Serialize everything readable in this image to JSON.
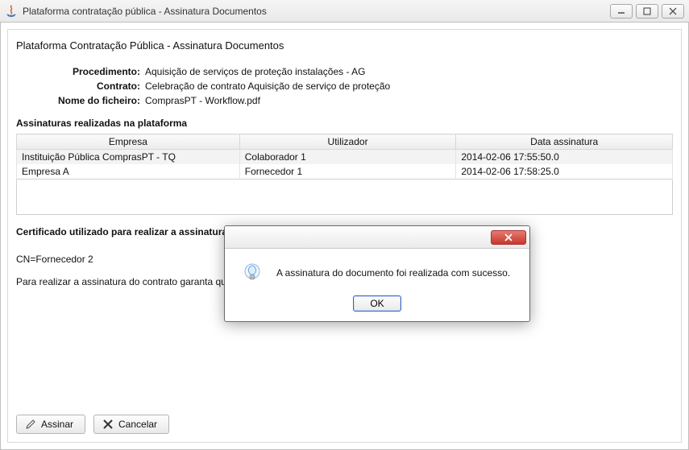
{
  "window": {
    "title": "Plataforma contratação pública - Assinatura Documentos"
  },
  "page": {
    "title": "Plataforma Contratação Pública - Assinatura Documentos"
  },
  "meta": {
    "procedimento_label": "Procedimento:",
    "procedimento_value": "Aquisição de serviços de proteção instalações - AG",
    "contrato_label": "Contrato:",
    "contrato_value": "Celebração de contrato Aquisição de serviço de proteção",
    "ficheiro_label": "Nome do ficheiro:",
    "ficheiro_value": "ComprasPT - Workflow.pdf"
  },
  "signatures": {
    "section_title": "Assinaturas realizadas na plataforma",
    "columns": {
      "empresa": "Empresa",
      "utilizador": "Utilizador",
      "data": "Data assinatura"
    },
    "rows": [
      {
        "empresa": "Instituição Pública ComprasPT - TQ",
        "utilizador": "Colaborador 1",
        "data": "2014-02-06 17:55:50.0"
      },
      {
        "empresa": "Empresa A",
        "utilizador": "Fornecedor 1",
        "data": "2014-02-06 17:58:25.0"
      }
    ]
  },
  "certificate": {
    "section_title": "Certificado utilizado para realizar a assinatura",
    "value": "CN=Fornecedor 2",
    "hint": "Para realizar a assinatura do contrato garanta que o cartão se encontra corretamente introduzido no leitor."
  },
  "buttons": {
    "assinar": "Assinar",
    "cancelar": "Cancelar"
  },
  "modal": {
    "message": "A assinatura do documento foi realizada com sucesso.",
    "ok": "OK"
  }
}
